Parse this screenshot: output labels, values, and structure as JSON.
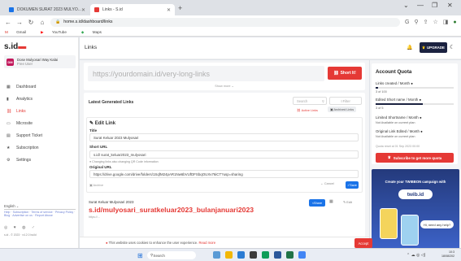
{
  "browser": {
    "tabs": [
      {
        "label": "DOKUMEN SURAT 2023 MULYO..."
      },
      {
        "label": "Links - S.id"
      }
    ],
    "new_tab": "+",
    "url": "home.s.id/dashboard/links",
    "bookmarks": [
      "Gmail",
      "YouTube",
      "Maps"
    ],
    "window_controls": [
      "⌄",
      "—",
      "❐",
      "✕"
    ]
  },
  "app": {
    "logo": "s.id",
    "user": {
      "initials": "DM",
      "name": "Dose Mulyosari Way Kalai",
      "plan": "Free User"
    },
    "nav": [
      {
        "icon": "grid",
        "label": "Dashboard"
      },
      {
        "icon": "chart",
        "label": "Analytics"
      },
      {
        "icon": "link",
        "label": "Links"
      },
      {
        "icon": "monitor",
        "label": "Microsite"
      },
      {
        "icon": "support",
        "label": "Support Ticket"
      },
      {
        "icon": "star",
        "label": "Subscription"
      },
      {
        "icon": "gear",
        "label": "Settings"
      }
    ],
    "language": "English ⌄",
    "side_links": "Help · Subscription · Terms of service · Privacy Policy · Blog · Advertise on us · Report Abuse",
    "socials": "◎ ♥ ◍ ♂",
    "copyright": "s.id - © 2023 · v4.2.0 build"
  },
  "topbar": {
    "title": "Links",
    "upgrade": "UPGRADE"
  },
  "shorten": {
    "placeholder": "https://yourdomain.id/very-long-links",
    "button": "Short It!",
    "show_more": "Show more ⌄"
  },
  "latest": {
    "title": "Latest Generated Links",
    "search_placeholder": "Search",
    "filter": "Filter",
    "active_tab": "Active Links",
    "archive_tab": "Archived Links"
  },
  "edit": {
    "title": "Edit Link",
    "title_label": "Title",
    "title_value": "Surat Keluar 2023 Mulyosari",
    "short_label": "Short URL",
    "short_value": "s.id/  surat_keluar2023_mulyosari",
    "hint": "Changing links also changing QR Code information",
    "orig_label": "Original URL",
    "orig_value": "https://drive.google.com/drive/folders/1SqfM24pAR1Nw6bVUfDFSbqOUXv76iCT?usp=sharing",
    "archive": "Archive",
    "cancel": "Cancel",
    "save": "Save"
  },
  "link_item": {
    "name": "Surat Keluar Mulyosari 2023",
    "short": "s.id/mulyosari_suratkeluar2023_bulanjanuari2023",
    "meta": "https://...",
    "share": "Share",
    "edit": "Edit"
  },
  "quota": {
    "title": "Account Quota",
    "items": [
      {
        "label": "Links created / Month",
        "value": "3 of 100",
        "fraction": 0.03
      },
      {
        "label": "Edited Short name / Month",
        "value": "3 of 5",
        "fraction": 0.6
      },
      {
        "label": "Limited Shortname / Month",
        "value": "Not Available on current plan",
        "fraction": 0
      },
      {
        "label": "Original Link Edited / Month",
        "value": "Not Available on current plan",
        "fraction": 0
      }
    ],
    "reset": "Quota reset at 01 Sep 2023 00:00",
    "subscribe": "Subscribe to get more quota"
  },
  "promo": {
    "heading": "Create your TWIBBON campaign with",
    "logo": "twib.id",
    "chat": "Hi, need any help?"
  },
  "cookie": {
    "text": "This website uses cookies to enhance the user experience.",
    "more": "Read more",
    "accept": "Accept"
  },
  "taskbar": {
    "search": "Search",
    "tray": "⌃ ☁ ◎ ◁)",
    "time": "10:3",
    "date": "18/08/202"
  },
  "colors": {
    "accent": "#e53935",
    "navy": "#1b2240",
    "blue": "#1a73e8"
  }
}
